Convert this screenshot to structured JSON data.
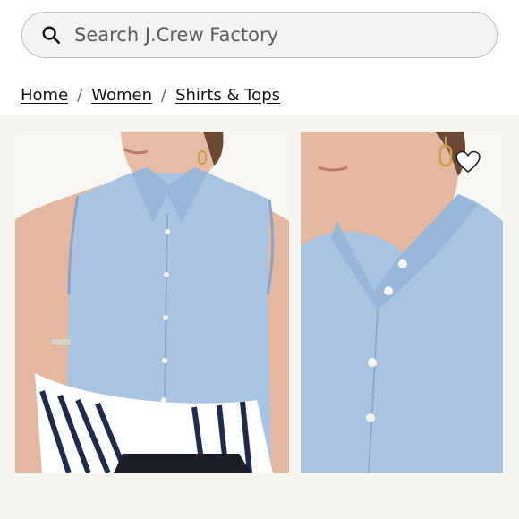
{
  "search": {
    "placeholder": "Search J.Crew Factory",
    "value": ""
  },
  "breadcrumb": [
    {
      "label": "Home"
    },
    {
      "label": "Women"
    },
    {
      "label": "Shirts & Tops"
    }
  ],
  "breadcrumb_separator": "/",
  "icons": {
    "search": "search-icon",
    "favorite": "heart-icon"
  },
  "colors": {
    "background": "#ffffff",
    "gallery_background": "#f6f4ef",
    "shirt": "#a8c4e2",
    "text": "#111111"
  }
}
